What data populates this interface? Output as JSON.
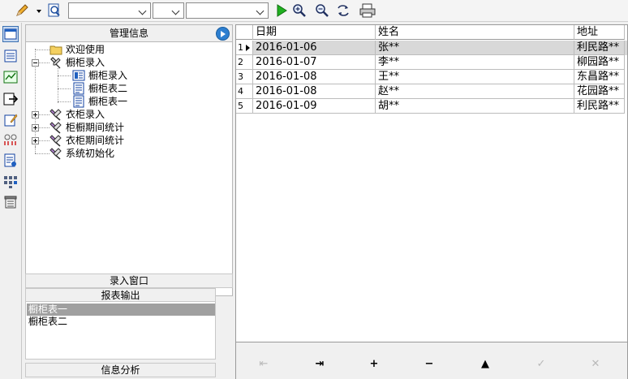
{
  "toolbar": {
    "combo1_value": "",
    "combo2_value": "",
    "combo3_value": ""
  },
  "management": {
    "title": "管理信息",
    "tree": [
      {
        "label": "欢迎使用"
      },
      {
        "label": "橱柜录入"
      },
      {
        "label": "橱柜录入"
      },
      {
        "label": "橱柜表二"
      },
      {
        "label": "橱柜表一"
      },
      {
        "label": "衣柜录入"
      },
      {
        "label": "柜橱期间统计"
      },
      {
        "label": "衣柜期间统计"
      },
      {
        "label": "系统初始化"
      }
    ],
    "sections": {
      "entry_window": "录入窗口",
      "report_output": "报表输出",
      "info_analysis": "信息分析"
    },
    "report_items": [
      "橱柜表一",
      "橱柜表二"
    ]
  },
  "grid": {
    "columns": [
      "日期",
      "姓名",
      "地址"
    ],
    "rows": [
      {
        "num": "1",
        "date": "2016-01-06",
        "name": "张**",
        "addr": "利民路**"
      },
      {
        "num": "2",
        "date": "2016-01-07",
        "name": "李**",
        "addr": "柳园路**"
      },
      {
        "num": "3",
        "date": "2016-01-08",
        "name": "王**",
        "addr": "东昌路**"
      },
      {
        "num": "4",
        "date": "2016-01-08",
        "name": "赵**",
        "addr": "花园路**"
      },
      {
        "num": "5",
        "date": "2016-01-09",
        "name": "胡**",
        "addr": "利民路**"
      }
    ]
  },
  "navigator": {
    "first": "⇤",
    "last": "⇥",
    "insert": "+",
    "delete": "−",
    "edit": "▲",
    "post": "✓",
    "cancel": "✕"
  },
  "icons": [
    "pencil-icon",
    "dropdown-arrow-icon",
    "find-icon",
    "run-icon",
    "zoom-in-icon",
    "zoom-out-icon",
    "refresh-icon",
    "printer-icon"
  ]
}
